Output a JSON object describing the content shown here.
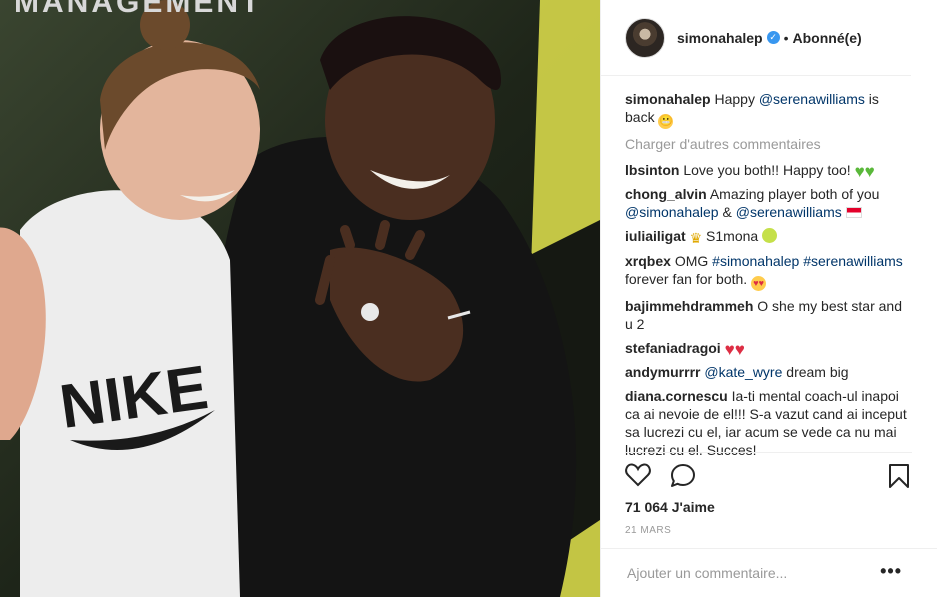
{
  "photo": {
    "top_text": "MANAGEMENT",
    "shirt_text": "NIKE"
  },
  "header": {
    "username": "simonahalep",
    "separator": "•",
    "follow_label": "Abonné(e)"
  },
  "caption": {
    "user": "simonahalep",
    "text_before": "Happy ",
    "mention": "@serenawilliams",
    "text_after": " is back"
  },
  "load_more": "Charger d'autres commentaires",
  "comments": [
    {
      "user": "lbsinton",
      "text": "Love you both!! Happy too!"
    },
    {
      "user": "chong_alvin",
      "text": "Amazing player both of you",
      "mention1": "@simonahalep",
      "amp": " & ",
      "mention2": "@serenawilliams"
    },
    {
      "user": "iuliailigat",
      "text": "S1mona"
    },
    {
      "user": "xrqbex",
      "text": "OMG",
      "tag1": "#simonahalep",
      "tag2": "#serenawilliams",
      "text2": "forever fan for both."
    },
    {
      "user": "bajimmehdrammeh",
      "text": "O she my best star and u 2"
    },
    {
      "user": "stefaniadragoi",
      "text": ""
    },
    {
      "user": "andymurrrr",
      "mention": "@kate_wyre",
      "text": " dream big"
    },
    {
      "user": "diana.cornescu",
      "text": "Ia-ti mental coach-ul inapoi ca ai nevoie de el!!! S-a vazut cand ai inceput sa lucrezi cu el, iar acum se vede ca nu mai lucrezi cu el. Succes!"
    }
  ],
  "likes": "71 064 J'aime",
  "date": "21 MARS",
  "add_comment_placeholder": "Ajouter un commentaire...",
  "more_label": "•••",
  "icons": [
    "heart-icon",
    "comment-icon",
    "bookmark-icon",
    "verified-icon"
  ]
}
